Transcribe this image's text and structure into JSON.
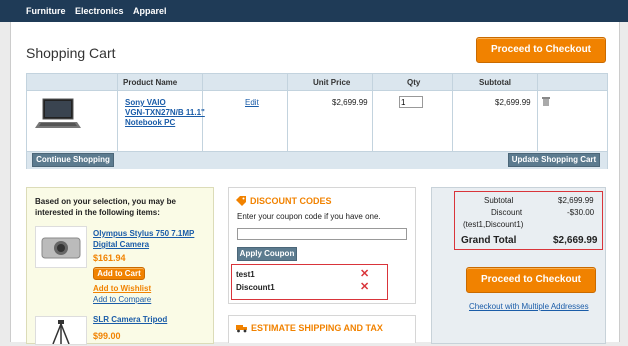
{
  "nav": {
    "items": [
      "Furniture",
      "Electronics",
      "Apparel"
    ]
  },
  "page": {
    "title": "Shopping Cart",
    "checkout_label": "Proceed to Checkout"
  },
  "cart": {
    "headers": [
      "Product Name",
      "Unit Price",
      "Qty",
      "Subtotal"
    ],
    "item": {
      "name_line1": "Sony VAIO",
      "name_line2": "VGN-TXN27N/B 11.1\"",
      "name_line3": "Notebook PC",
      "edit_label": "Edit",
      "unit_price": "$2,699.99",
      "qty": "1",
      "subtotal": "$2,699.99"
    },
    "continue_label": "Continue Shopping",
    "update_label": "Update Shopping Cart"
  },
  "crosssell": {
    "heading_line1": "Based on your selection, you may be",
    "heading_line2": "interested in the following items:",
    "products": [
      {
        "name_line1": "Olympus Stylus 750 7.1MP",
        "name_line2": "Digital Camera",
        "price": "$161.94",
        "add_to_cart": "Add to Cart",
        "wishlist": "Add to Wishlist",
        "compare": "Add to Compare"
      },
      {
        "name_line1": "SLR Camera Tripod",
        "price": "$99.00"
      }
    ]
  },
  "discount": {
    "title": "DISCOUNT CODES",
    "prompt": "Enter your coupon code if you have one.",
    "input_value": "",
    "apply_label": "Apply Coupon",
    "codes": [
      "test1",
      "Discount1"
    ]
  },
  "shipping": {
    "title": "ESTIMATE SHIPPING AND TAX"
  },
  "totals": {
    "subtotal_label": "Subtotal",
    "subtotal_value": "$2,699.99",
    "discount_label": "Discount",
    "discount_detail": "(test1,Discount1)",
    "discount_value": "-$30.00",
    "grand_label": "Grand Total",
    "grand_value": "$2,669.99",
    "checkout_label": "Proceed to Checkout",
    "multi_label": "Checkout with Multiple Addresses"
  },
  "colors": {
    "accent": "#f18200",
    "nav": "#1f3b57",
    "highlight": "#d9343a"
  }
}
